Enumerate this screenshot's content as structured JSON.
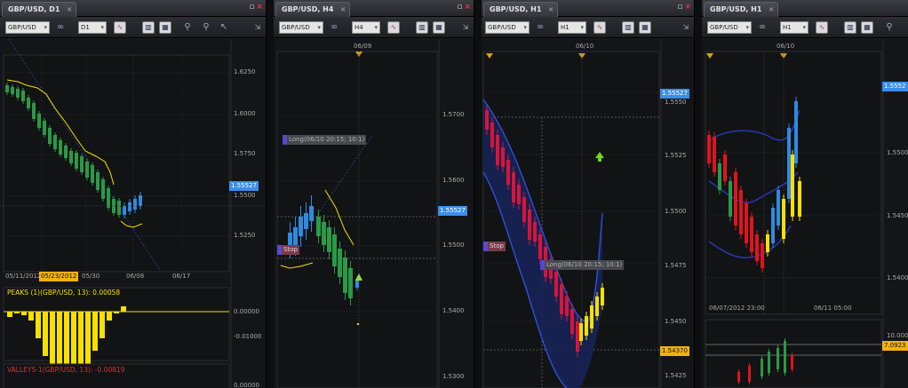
{
  "toolbar_icons": [
    "cursor-icon",
    "chart-type-icon",
    "template-icon",
    "layout-icon",
    "zoom-in-icon",
    "zoom-out-icon",
    "pointer-icon",
    "expand-icon"
  ],
  "panes": [
    {
      "tab": "GBP/USD, D1",
      "symbol": "GBP/USD",
      "timeframe": "D1",
      "price_labels": [
        "1.6250",
        "1.6000",
        "1.5750",
        "1.5500",
        "1.5250"
      ],
      "current_price": "1.55527",
      "time_labels": [
        "05/11/2012",
        "05/23/2012",
        "05/30",
        "06/08",
        "06/17"
      ],
      "indicator1_title": "PEAKS (1)(GBP/USD, 13): 0.00058",
      "indicator1_scale": [
        "0.00000",
        "-0.01000"
      ],
      "indicator2_title": "VALLEYS-1(GBP/USD, 13): -0.00819",
      "indicator2_scale": [
        "0.00000"
      ]
    },
    {
      "tab": "GBP/USD, H4",
      "symbol": "GBP/USD",
      "timeframe": "H4",
      "date_marker": "06/09",
      "price_labels": [
        "1.5700",
        "1.5600",
        "1.5500",
        "1.5400",
        "1.5300"
      ],
      "current_price": "1.55527",
      "long_label": "Long(06/10 20:15; 10:1)",
      "stop_label": "Stop"
    },
    {
      "tab": "GBP/USD, H1",
      "symbol": "GBP/USD",
      "timeframe": "H1",
      "date_marker": "06/10",
      "price_labels": [
        "1.5550",
        "1.5525",
        "1.5500",
        "1.5475",
        "1.5450",
        "1.5425"
      ],
      "current_price": "1.55527",
      "lower_price": "1.54370",
      "long_label": "Long(06/10 20:15; 10:1)",
      "stop_label": "Stop"
    },
    {
      "tab": "GBP/USD, H1",
      "symbol": "GBP/USD",
      "timeframe": "H1",
      "date_marker": "06/10",
      "price_labels": [
        "1.5500",
        "1.5450",
        "1.5400"
      ],
      "current_price": "1.5552",
      "time_labels": [
        "06/07/2012 23:00",
        "06/11 05:00"
      ],
      "indicator_scale": [
        "10.000"
      ],
      "indicator_value": "7.0923"
    }
  ]
}
